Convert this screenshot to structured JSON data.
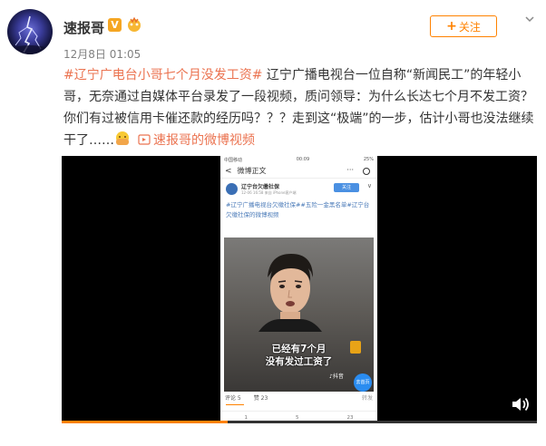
{
  "user": {
    "name": "速报哥",
    "badge": "V",
    "timestamp": "12月8日 01:05"
  },
  "follow_button": {
    "plus": "+",
    "label": "关注"
  },
  "post": {
    "topic": "#辽宁广电台小哥七个月没发工资#",
    "body": " 辽宁广播电视台一位自称“新闻民工”的年轻小哥，无奈通过自媒体平台录发了一段视频，质问领导：为什么长达七个月不发工资？你们有过被信用卡催还款的经历吗？？？走到这“极端”的一步，估计小哥也没法继续干了……",
    "video_link": "速报哥的微博视频"
  },
  "video": {
    "progress": 0.35,
    "phone": {
      "status_left": "中国移动",
      "status_center": "00:09",
      "status_right": "25%",
      "nav_title": "微博正文",
      "nav_back": "<",
      "nav_more": "···",
      "author_name": "辽宁台欠缴社保",
      "author_meta": "12-06 16:58 来自 iPhone客户端",
      "follow": "关注",
      "menu": "∨",
      "text": "#辽宁广播电视台欠缴社保##五险一金黑名单#辽宁台欠缴社保的微博视频",
      "caption_line1": "已经有7个月",
      "caption_line2": "没有发过工资了",
      "tiktok": "♪抖音",
      "goto": "去首页",
      "comments": "评论 5",
      "likes": "赞 23",
      "reposts_hint": "转发",
      "bottom_repost": "1",
      "bottom_comment": "5",
      "bottom_like": "23"
    }
  },
  "colors": {
    "accent": "#ff8200",
    "topic": "#eb7350"
  }
}
